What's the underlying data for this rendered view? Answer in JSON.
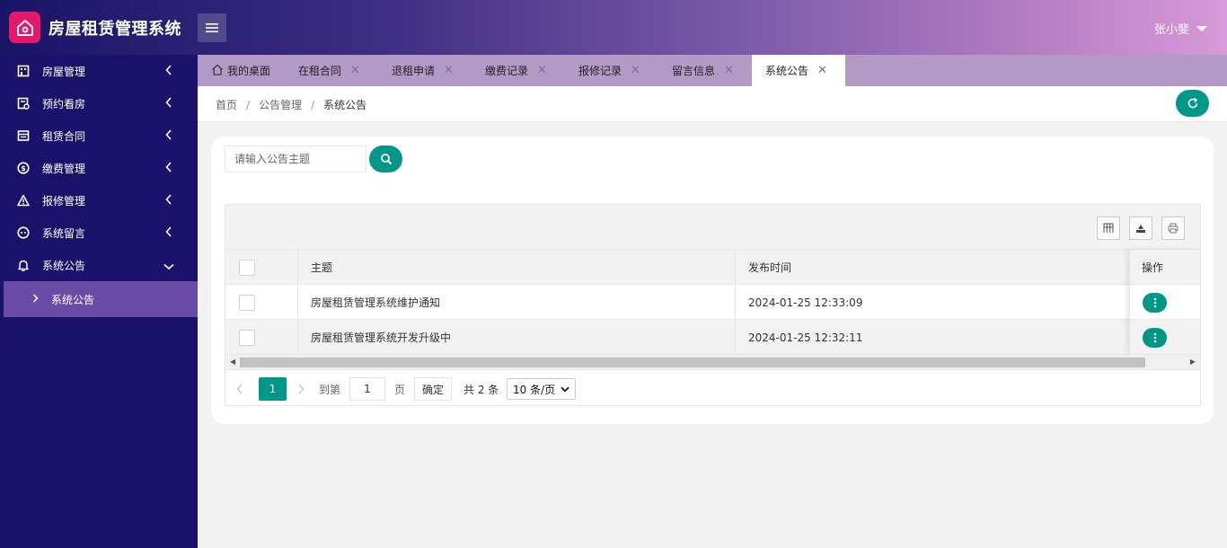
{
  "app": {
    "title": "房屋租赁管理系统",
    "user_name": "张小斐"
  },
  "sidebar": {
    "items": [
      {
        "label": "房屋管理",
        "icon": "building-icon"
      },
      {
        "label": "预约看房",
        "icon": "calendar-check-icon"
      },
      {
        "label": "租赁合同",
        "icon": "contract-icon"
      },
      {
        "label": "缴费管理",
        "icon": "dollar-circle-icon"
      },
      {
        "label": "报修管理",
        "icon": "warning-icon"
      },
      {
        "label": "系统留言",
        "icon": "message-icon"
      },
      {
        "label": "系统公告",
        "icon": "bell-icon"
      }
    ],
    "active_sub": "系统公告"
  },
  "tabs": [
    {
      "label": "我的桌面",
      "closable": false
    },
    {
      "label": "在租合同",
      "closable": true
    },
    {
      "label": "退租申请",
      "closable": true
    },
    {
      "label": "缴费记录",
      "closable": true
    },
    {
      "label": "报修记录",
      "closable": true
    },
    {
      "label": "留言信息",
      "closable": true
    },
    {
      "label": "系统公告",
      "closable": true,
      "active": true
    }
  ],
  "breadcrumb": [
    "首页",
    "公告管理",
    "系统公告"
  ],
  "search": {
    "placeholder": "请输入公告主题",
    "value": ""
  },
  "table": {
    "headers": {
      "subject": "主题",
      "publish_time": "发布时间",
      "actions": "操作"
    },
    "rows": [
      {
        "subject": "房屋租赁管理系统维护通知",
        "publish_time": "2024-01-25 12:33:09"
      },
      {
        "subject": "房屋租赁管理系统开发升级中",
        "publish_time": "2024-01-25 12:32:11"
      }
    ]
  },
  "pagination": {
    "current_page": "1",
    "goto_label": "到第",
    "goto_value": "1",
    "page_unit": "页",
    "confirm": "确定",
    "total_text": "共 2 条",
    "page_size_selected": "10 条/页"
  },
  "colors": {
    "accent": "#009688",
    "sidebar_bg": "#1b136b",
    "sidebar_active": "#6a4ca6",
    "logo_bg": "#e8176c"
  }
}
